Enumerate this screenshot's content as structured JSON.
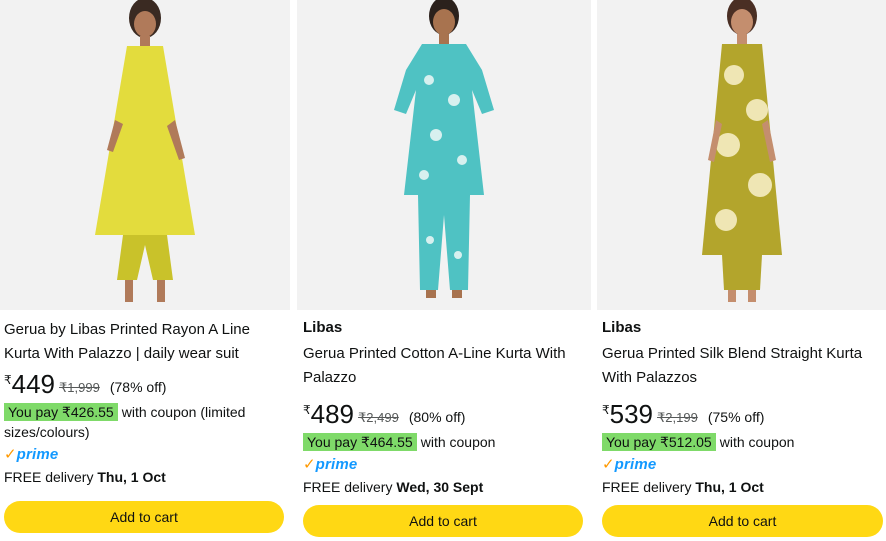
{
  "products": [
    {
      "brand": "",
      "title": "Gerua by Libas Printed Rayon A Line Kurta With Palazzo | daily wear suit",
      "currency": "₹",
      "price": "449",
      "mrp": "₹1,999",
      "discount": "(78% off)",
      "you_pay": "You pay ₹426.55",
      "coupon_text": "with coupon (limited sizes/colours)",
      "prime_check": "✓",
      "prime_word": "prime",
      "delivery_prefix": "FREE delivery",
      "delivery_date": "Thu, 1 Oct",
      "cart_label": "Add to cart",
      "colors": {
        "kurta": "#e3dc3d",
        "accent": "#c9c22a"
      }
    },
    {
      "brand": "Libas",
      "title": "Gerua Printed Cotton A-Line Kurta With Palazzo",
      "currency": "₹",
      "price": "489",
      "mrp": "₹2,499",
      "discount": "(80% off)",
      "you_pay": "You pay ₹464.55",
      "coupon_text": "with coupon",
      "prime_check": "✓",
      "prime_word": "prime",
      "delivery_prefix": "FREE delivery",
      "delivery_date": "Wed, 30 Sept",
      "cart_label": "Add to cart",
      "colors": {
        "kurta": "#4fc2c3",
        "accent": "#d7f0ef"
      }
    },
    {
      "brand": "Libas",
      "title": "Gerua Printed Silk Blend Straight Kurta With Palazzos",
      "currency": "₹",
      "price": "539",
      "mrp": "₹2,199",
      "discount": "(75% off)",
      "you_pay": "You pay ₹512.05",
      "coupon_text": "with coupon",
      "prime_check": "✓",
      "prime_word": "prime",
      "delivery_prefix": "FREE delivery",
      "delivery_date": "Thu, 1 Oct",
      "cart_label": "Add to cart",
      "colors": {
        "kurta": "#b3a52c",
        "accent": "#efe6b4"
      }
    }
  ]
}
